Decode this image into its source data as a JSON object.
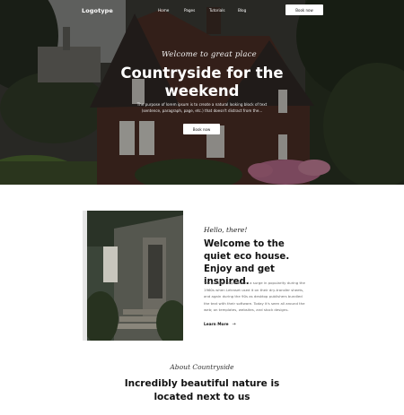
{
  "nav": {
    "logo": "Logotype",
    "links": [
      "Home",
      "Pages",
      "Tutorials",
      "Blog"
    ],
    "cta": "Book now"
  },
  "hero": {
    "script": "Welcome to great place",
    "title": "Countryside for the weekend",
    "description": "The purpose of lorem ipsum is to create a natural looking block of text (sentence, paragraph, page, etc.) that doesn't distract from the...",
    "button": "Book now"
  },
  "about": {
    "script": "Hello, there!",
    "title": "Welcome to the quiet eco house. Enjoy and get inspired.",
    "text": "The passage experienced a surge in popularity during the 1960s when Letraset used it on their dry-transfer sheets, and again during the 90s as desktop publishers bundled the text with their software. Today it's seen all around the web; on templates, websites, and stock designs.",
    "link": "Learn More",
    "link_arrow": "→"
  },
  "next_section": {
    "script": "About Countryside",
    "title": "Incredibly beautiful nature is located next to us"
  },
  "colors": {
    "text": "#111111",
    "muted": "#666666",
    "button_bg": "#ffffff"
  }
}
